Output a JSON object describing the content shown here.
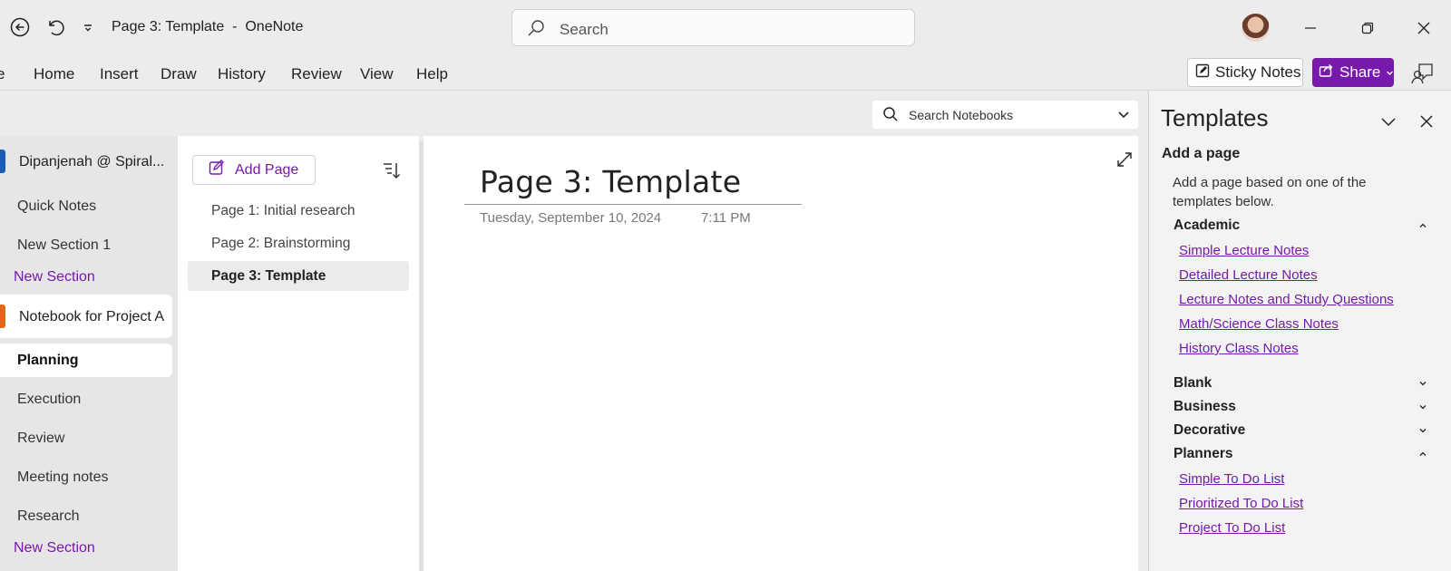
{
  "window": {
    "title": "Page 3: Template  -  OneNote",
    "search_placeholder": "Search"
  },
  "ribbon": {
    "tabs": [
      "Home",
      "Insert",
      "Draw",
      "History",
      "Review",
      "View",
      "Help"
    ],
    "sticky_notes_label": "Sticky Notes",
    "share_label": "Share"
  },
  "notebook_search": {
    "placeholder": "Search Notebooks"
  },
  "notebooks": [
    {
      "name": "Dipanjenah @ Spiral...",
      "color": "#1a5bb5",
      "sections": [
        "Quick Notes",
        "New Section 1"
      ],
      "new_section_label": "New Section"
    },
    {
      "name": "Notebook for Project A",
      "color": "#e0681a",
      "sections": [
        "Planning",
        "Execution",
        "Review",
        "Meeting notes",
        "Research"
      ],
      "active_section": "Planning",
      "new_section_label": "New Section"
    }
  ],
  "page_list": {
    "add_page_label": "Add Page",
    "pages": [
      "Page 1: Initial research",
      "Page 2: Brainstorming",
      "Page 3: Template"
    ],
    "active_page": "Page 3: Template"
  },
  "page": {
    "title": "Page 3: Template",
    "date": "Tuesday, September 10, 2024",
    "time": "7:11 PM"
  },
  "templates_pane": {
    "title": "Templates",
    "subtitle": "Add a page",
    "description": "Add a page based on one of the templates below.",
    "categories": [
      {
        "name": "Academic",
        "expanded": true,
        "items": [
          "Simple Lecture Notes",
          "Detailed Lecture Notes",
          "Lecture Notes and Study Questions",
          "Math/Science Class Notes",
          "History Class Notes"
        ]
      },
      {
        "name": "Blank",
        "expanded": false,
        "items": []
      },
      {
        "name": "Business",
        "expanded": false,
        "items": []
      },
      {
        "name": "Decorative",
        "expanded": false,
        "items": []
      },
      {
        "name": "Planners",
        "expanded": true,
        "items": [
          "Simple To Do List",
          "Prioritized To Do List",
          "Project To Do List"
        ]
      }
    ]
  },
  "colors": {
    "accent": "#7719aa"
  }
}
